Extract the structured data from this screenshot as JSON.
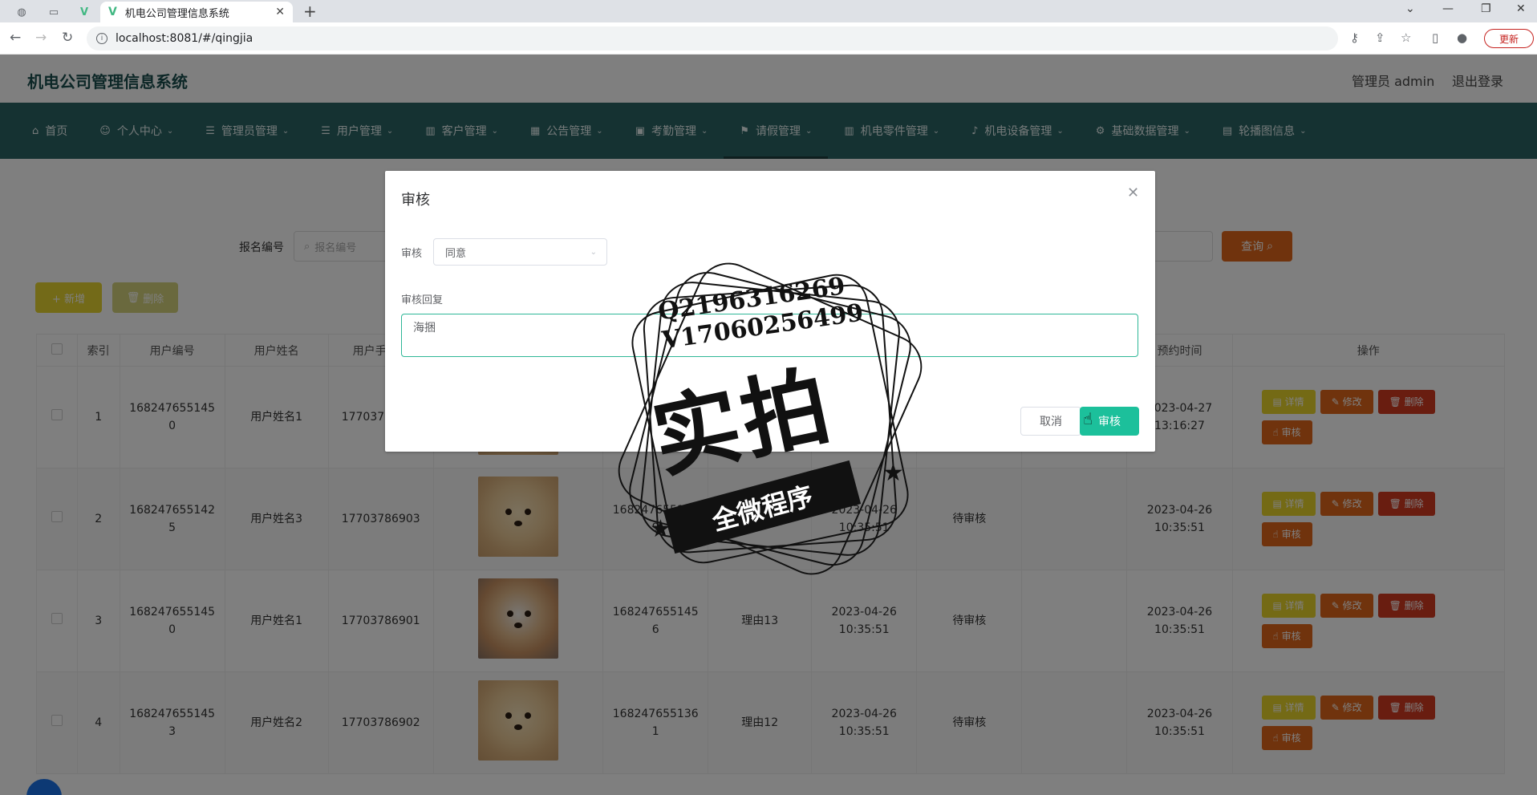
{
  "browser": {
    "tab_title": "机电公司管理信息系统",
    "tab_logo": "V",
    "new_tab": "+",
    "url": "localhost:8081/#/qingjia",
    "update_label": "更新"
  },
  "header": {
    "title": "机电公司管理信息系统",
    "user": "管理员 admin",
    "logout": "退出登录"
  },
  "menu": [
    {
      "label": "首页",
      "icon": "home-icon"
    },
    {
      "label": "个人中心",
      "icon": "user-icon"
    },
    {
      "label": "管理员管理",
      "icon": "list-icon"
    },
    {
      "label": "用户管理",
      "icon": "list-icon"
    },
    {
      "label": "客户管理",
      "icon": "chart-icon"
    },
    {
      "label": "公告管理",
      "icon": "grid-icon"
    },
    {
      "label": "考勤管理",
      "icon": "briefcase-icon"
    },
    {
      "label": "请假管理",
      "icon": "flag-icon",
      "active": true
    },
    {
      "label": "机电零件管理",
      "icon": "chart-icon"
    },
    {
      "label": "机电设备管理",
      "icon": "mic-icon"
    },
    {
      "label": "基础数据管理",
      "icon": "gear-icon"
    },
    {
      "label": "轮播图信息",
      "icon": "image-icon"
    }
  ],
  "search": {
    "label": "报名编号",
    "placeholder": "报名编号",
    "button": "查询"
  },
  "toolbar": {
    "add": "+ 新增",
    "delete": "删除"
  },
  "table": {
    "headers": [
      "索引",
      "用户编号",
      "用户姓名",
      "用户手机号",
      "",
      "",
      "",
      "",
      "",
      "",
      "",
      "预约时间",
      "操作"
    ],
    "rows": [
      {
        "index": "1",
        "user_no": "1682476551450",
        "name": "用户姓名1",
        "phone": "17703786901",
        "no": "",
        "reason": "",
        "time": "",
        "status": "",
        "reply": "",
        "appt": "2023-04-27 13:16:27"
      },
      {
        "index": "2",
        "user_no": "1682476551425",
        "name": "用户姓名3",
        "phone": "17703786903",
        "no": "1682476551449",
        "reason": "理由",
        "time": "2023-04-26 10:35:51",
        "status": "待审核",
        "reply": "",
        "appt": "2023-04-26 10:35:51"
      },
      {
        "index": "3",
        "user_no": "1682476551450",
        "name": "用户姓名1",
        "phone": "17703786901",
        "no": "1682476551456",
        "reason": "理由13",
        "time": "2023-04-26 10:35:51",
        "status": "待审核",
        "reply": "",
        "appt": "2023-04-26 10:35:51"
      },
      {
        "index": "4",
        "user_no": "1682476551453",
        "name": "用户姓名2",
        "phone": "17703786902",
        "no": "1682476551361",
        "reason": "理由12",
        "time": "2023-04-26 10:35:51",
        "status": "待审核",
        "reply": "",
        "appt": "2023-04-26 10:35:51"
      }
    ],
    "actions": {
      "detail": "详情",
      "edit": "修改",
      "delete": "删除",
      "audit": "审核"
    }
  },
  "dialog": {
    "title": "审核",
    "audit_label": "审核",
    "audit_value": "同意",
    "reply_label": "审核回复",
    "reply_value": "海捆",
    "cancel": "取消",
    "confirm": "审核"
  },
  "watermark": {
    "qq": "Q2196316269",
    "vx": "V17060256499",
    "main": "实拍",
    "banner": "全微程序"
  }
}
